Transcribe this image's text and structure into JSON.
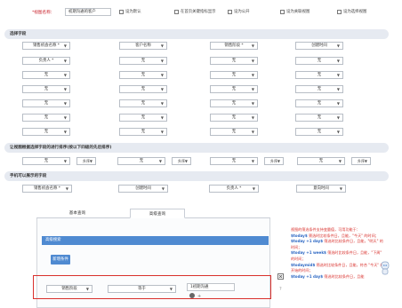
{
  "top": {
    "name_label": "*视图名称：",
    "name_value": "初期沟通的客户",
    "checks": [
      "设为默认",
      "在首页关键指标显示",
      "设为公开",
      "设为关联视图",
      "设为选择视图"
    ]
  },
  "sections": {
    "select_fields": "选择字段",
    "sort": "让视图根据选择字段的进行排序(按以下四级的先后排序)",
    "mobile": "手机可以展示的字段"
  },
  "field_rows": [
    [
      "销售机会名称 *",
      "客户名称",
      "销售阶段 *",
      "创建时间"
    ],
    [
      "负责人 *",
      "无",
      "无",
      "无"
    ],
    [
      "无",
      "无",
      "无",
      "无"
    ],
    [
      "无",
      "无",
      "无",
      "无"
    ],
    [
      "无",
      "无",
      "无",
      "无"
    ],
    [
      "无",
      "无",
      "无",
      "无"
    ],
    [
      "无",
      "无",
      "无",
      "无"
    ]
  ],
  "sort_row": [
    {
      "field": "无",
      "order": "升序"
    },
    {
      "field": "无",
      "order": "升序"
    },
    {
      "field": "无",
      "order": "升序"
    },
    {
      "field": "无",
      "order": "升序"
    }
  ],
  "mobile_row": [
    "销售机会名称 *",
    "创建时间",
    "负责人 *",
    "意向时间"
  ],
  "tabs": [
    "基本查询",
    "高级查询"
  ],
  "advanced": {
    "panel_title": "高级搜索",
    "add_button": "新增条件",
    "condition": {
      "field": "销售阶段",
      "operator": "等于",
      "value": "1初期沟通"
    }
  },
  "note": {
    "intro": "视图的筛选条件支持变量值，可用功能于：",
    "items": [
      {
        "key": "$today$",
        "desc": "筛选时比较条件日，且能，\"今天\" 的时间；"
      },
      {
        "key": "$today +1 day$",
        "desc": "筛选时比较条件日，且能，\"明天\" 的时间；"
      },
      {
        "key": "$today +1 week$",
        "desc": "筛选时比较条件日，且能，\"下周\" 的时间；"
      },
      {
        "key": "$todaymid$",
        "desc": "筛选时比较条件日，且能，符合 \"今天\" 的开始的时间；"
      },
      {
        "key": "$today +1 day$",
        "desc": "筛选时比较条件日，且能"
      }
    ]
  },
  "colors": {
    "accent": "#4f8ad1",
    "required": "#c8202a",
    "highlight": "#d9302c",
    "section_bg": "#e6eaf1"
  }
}
